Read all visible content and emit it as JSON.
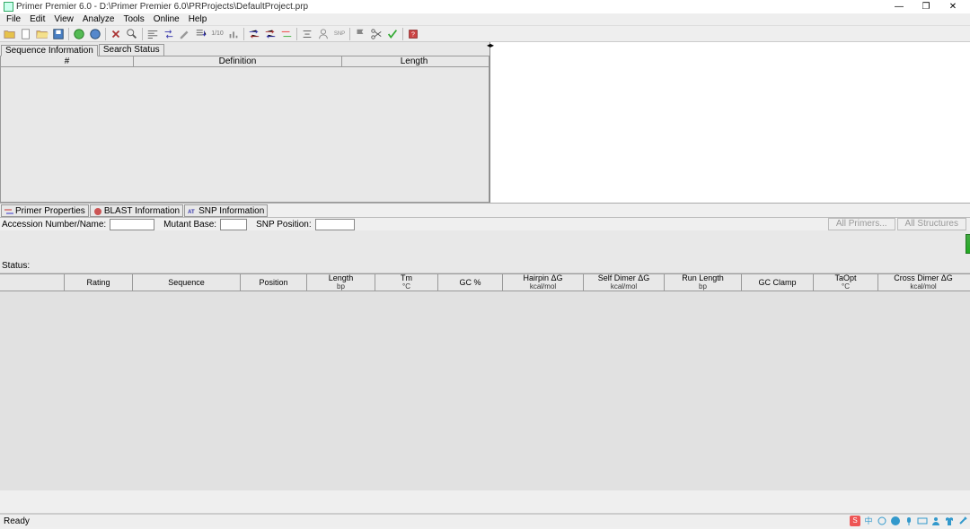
{
  "window": {
    "title": "Primer Premier 6.0 - D:\\Primer Premier 6.0\\PRProjects\\DefaultProject.prp"
  },
  "menu": [
    "File",
    "Edit",
    "View",
    "Analyze",
    "Tools",
    "Online",
    "Help"
  ],
  "seq_tabs": [
    "Sequence Information",
    "Search Status"
  ],
  "seq_table": {
    "col_num": "#",
    "col_def": "Definition",
    "col_len": "Length"
  },
  "mid_tabs": [
    "Primer Properties",
    "BLAST Information",
    "SNP Information"
  ],
  "form": {
    "acc_label": "Accession Number/Name:",
    "mut_label": "Mutant Base:",
    "snp_label": "SNP Position:"
  },
  "buttons": {
    "all_primers": "All Primers...",
    "all_struct": "All Structures"
  },
  "status_label": "Status:",
  "primer_cols": {
    "rating": "Rating",
    "seq": "Sequence",
    "pos": "Position",
    "len": "Length",
    "len_u": "bp",
    "tm": "Tm",
    "tm_u": "°C",
    "gc": "GC %",
    "hair": "Hairpin ΔG",
    "hair_u": "kcal/mol",
    "self": "Self Dimer ΔG",
    "self_u": "kcal/mol",
    "run": "Run Length",
    "run_u": "bp",
    "gcc": "GC Clamp",
    "taopt": "TaOpt",
    "taopt_u": "°C",
    "cross": "Cross Dimer ΔG",
    "cross_u": "kcal/mol"
  },
  "statusbar": "Ready",
  "tray_ime": "中"
}
